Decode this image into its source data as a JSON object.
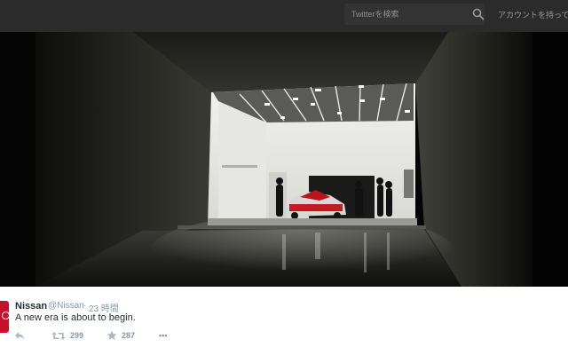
{
  "header": {
    "search_placeholder": "Twitterを検索",
    "account_label": "アカウントを持ってい",
    "search_icon": "search-icon"
  },
  "media": {
    "description_icon": "photo"
  },
  "tweet": {
    "name": "Nissan",
    "handle": "@Nissan",
    "separator": "·",
    "time": "23 時間",
    "text": "A new era is about to begin.",
    "retweets": "299",
    "favorites": "287",
    "more": "•••"
  },
  "colors": {
    "topbar": "#2b2b2b",
    "brand_red": "#c8102e",
    "meta_gray": "#8899a6",
    "text_dark": "#292f33"
  }
}
